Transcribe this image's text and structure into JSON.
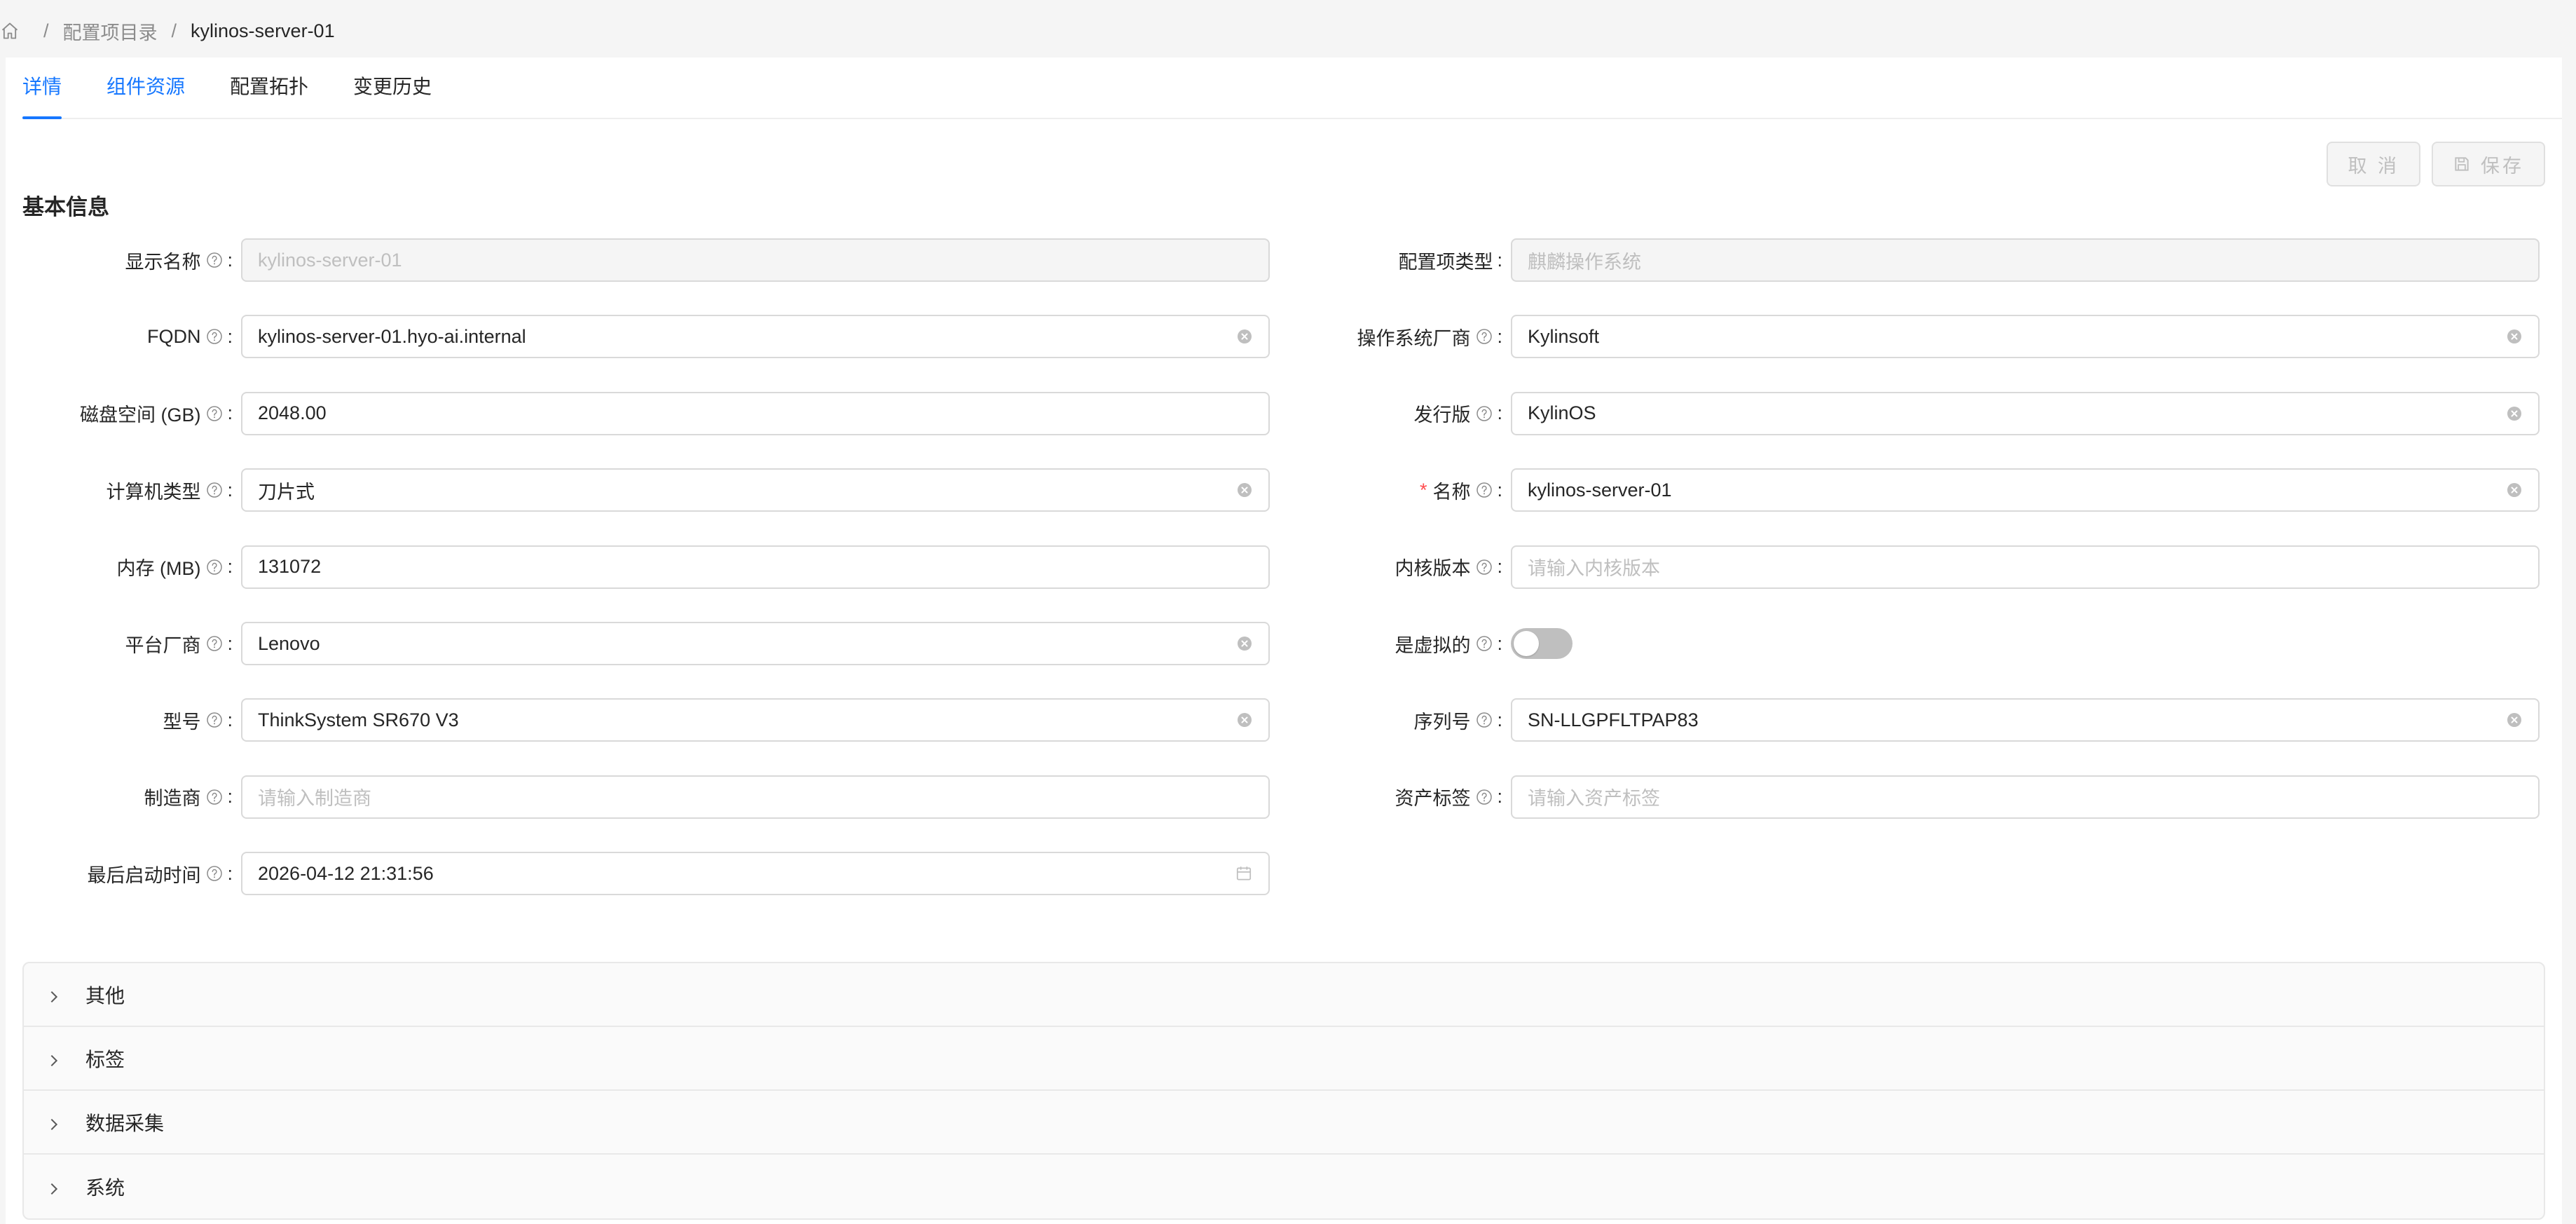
{
  "breadcrumb": {
    "items": [
      "配置项目录",
      "kylinos-server-01"
    ],
    "separator": "/"
  },
  "tabs": [
    {
      "label": "详情",
      "state": "active"
    },
    {
      "label": "组件资源",
      "state": "link"
    },
    {
      "label": "配置拓扑",
      "state": "normal"
    },
    {
      "label": "变更历史",
      "state": "normal"
    }
  ],
  "actions": {
    "cancel_label": "取 消",
    "save_label": "保存"
  },
  "section_title": "基本信息",
  "form": {
    "left": [
      {
        "label": "显示名称",
        "value": "kylinos-server-01",
        "placeholder": "",
        "state": "disabled",
        "clearable": false
      },
      {
        "label": "FQDN",
        "value": "kylinos-server-01.hyo-ai.internal",
        "placeholder": "",
        "state": "normal",
        "clearable": true
      },
      {
        "label": "磁盘空间 (GB)",
        "value": "2048.00",
        "placeholder": "",
        "state": "normal",
        "clearable": false
      },
      {
        "label": "计算机类型",
        "value": "刀片式",
        "placeholder": "",
        "state": "normal",
        "clearable": true
      },
      {
        "label": "内存 (MB)",
        "value": "131072",
        "placeholder": "",
        "state": "normal",
        "clearable": false
      },
      {
        "label": "平台厂商",
        "value": "Lenovo",
        "placeholder": "",
        "state": "normal",
        "clearable": true
      },
      {
        "label": "型号",
        "value": "ThinkSystem SR670 V3",
        "placeholder": "",
        "state": "normal",
        "clearable": true
      },
      {
        "label": "制造商",
        "value": "",
        "placeholder": "请输入制造商",
        "state": "normal",
        "clearable": false
      },
      {
        "label": "最后启动时间",
        "value": "2026-04-12 21:31:56",
        "placeholder": "",
        "state": "date",
        "clearable": false
      }
    ],
    "right": [
      {
        "label": "配置项类型",
        "value": "麒麟操作系统",
        "placeholder": "",
        "state": "disabled",
        "help": false,
        "required": false,
        "clearable": false
      },
      {
        "label": "操作系统厂商",
        "value": "Kylinsoft",
        "placeholder": "",
        "state": "normal",
        "help": true,
        "required": false,
        "clearable": true
      },
      {
        "label": "发行版",
        "value": "KylinOS",
        "placeholder": "",
        "state": "normal",
        "help": true,
        "required": false,
        "clearable": true
      },
      {
        "label": "名称",
        "value": "kylinos-server-01",
        "placeholder": "",
        "state": "normal",
        "help": true,
        "required": true,
        "clearable": true
      },
      {
        "label": "内核版本",
        "value": "",
        "placeholder": "请输入内核版本",
        "state": "normal",
        "help": true,
        "required": false,
        "clearable": false
      },
      {
        "label": "是虚拟的",
        "value": "off",
        "placeholder": "",
        "state": "switch",
        "help": true,
        "required": false,
        "clearable": false
      },
      {
        "label": "序列号",
        "value": "SN-LLGPFLTPAP83",
        "placeholder": "",
        "state": "normal",
        "help": true,
        "required": false,
        "clearable": true
      },
      {
        "label": "资产标签",
        "value": "",
        "placeholder": "请输入资产标签",
        "state": "normal",
        "help": true,
        "required": false,
        "clearable": false
      }
    ]
  },
  "collapse_panels": [
    "其他",
    "标签",
    "数据采集",
    "系统"
  ],
  "colors": {
    "accent": "#1677ff",
    "required": "#ff4d4f",
    "switch_off": "#bfbfbf"
  },
  "icons": {
    "home": "home-icon",
    "help": "question-circle-icon",
    "clear": "close-circle-icon",
    "calendar": "calendar-icon",
    "save": "save-icon",
    "chevron": "chevron-right-icon"
  }
}
